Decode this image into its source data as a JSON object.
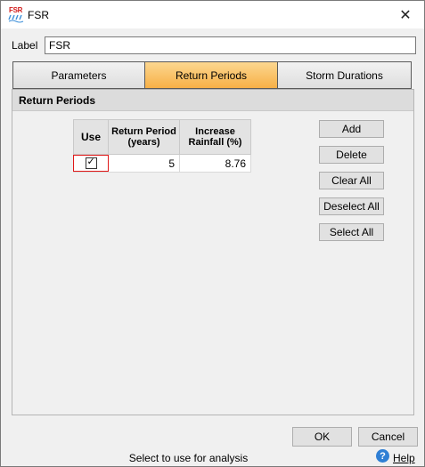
{
  "window": {
    "icon_text": "FSR",
    "title": "FSR",
    "close_glyph": "✕"
  },
  "label": {
    "caption": "Label",
    "value": "FSR"
  },
  "tabs": [
    {
      "label": "Parameters",
      "active": false
    },
    {
      "label": "Return Periods",
      "active": true
    },
    {
      "label": "Storm Durations",
      "active": false
    }
  ],
  "panel": {
    "title": "Return Periods"
  },
  "table": {
    "headers": {
      "use": "Use",
      "return_period": "Return Period (years)",
      "increase_rainfall": "Increase Rainfall (%)"
    },
    "rows": [
      {
        "use": true,
        "return_period": "5",
        "increase_rainfall": "8.76"
      }
    ]
  },
  "buttons": {
    "add": "Add",
    "delete": "Delete",
    "clear_all": "Clear All",
    "deselect_all": "Deselect All",
    "select_all": "Select All",
    "ok": "OK",
    "cancel": "Cancel"
  },
  "status": {
    "text": "Select to use for analysis",
    "help": "Help"
  },
  "colors": {
    "active_tab": "#f7b046",
    "highlight_outline": "#e01818",
    "help_icon": "#2f7fd4"
  },
  "icons": {
    "app": "fsr-app-icon",
    "close": "close-icon",
    "checkbox": "checkbox-checked-icon",
    "help": "help-icon"
  }
}
